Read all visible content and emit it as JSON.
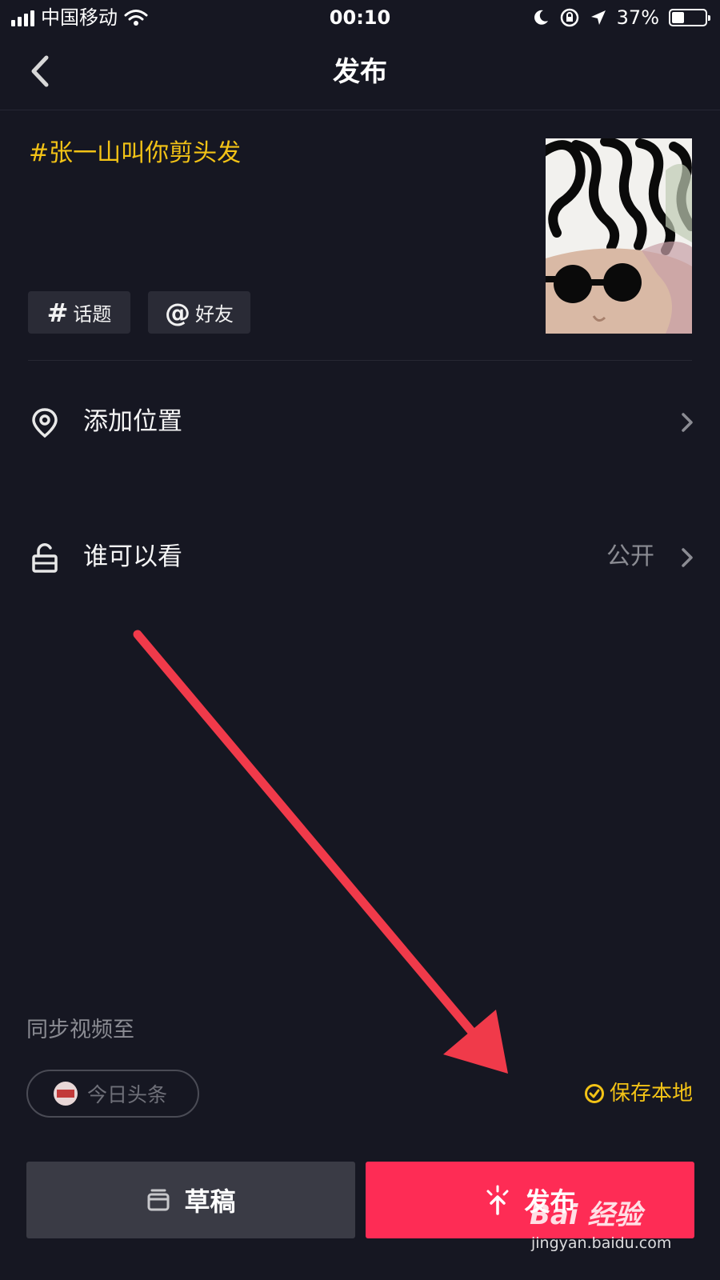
{
  "status_bar": {
    "carrier": "中国移动",
    "time": "00:10",
    "battery_percent": "37%",
    "battery_level": 0.37
  },
  "nav": {
    "title": "发布"
  },
  "post": {
    "caption": "#张一山叫你剪头发",
    "chips": {
      "topic_symbol": "#",
      "topic": "话题",
      "friend_symbol": "@",
      "friend": "好友"
    }
  },
  "rows": {
    "location_label": "添加位置",
    "visibility_label": "谁可以看",
    "visibility_value": "公开"
  },
  "sync": {
    "label": "同步视频至",
    "toutiao": "今日头条",
    "save_local": "保存本地"
  },
  "actions": {
    "draft": "草稿",
    "publish": "发布"
  },
  "watermark": {
    "brand": "Bai 经验",
    "url": "jingyan.baidu.com"
  },
  "colors": {
    "background": "#161722",
    "accent_yellow": "#f3c316",
    "publish_red": "#fe2c55",
    "draft_gray": "#3a3b45",
    "annotation_arrow": "#f03a4a"
  },
  "icons": {
    "back": "chevron-left-icon",
    "location": "location-pin-icon",
    "visibility": "unlock-icon",
    "chevron": "chevron-right-icon",
    "save_local": "check-circle-icon",
    "draft": "draft-box-icon",
    "publish": "publish-spark-icon"
  }
}
